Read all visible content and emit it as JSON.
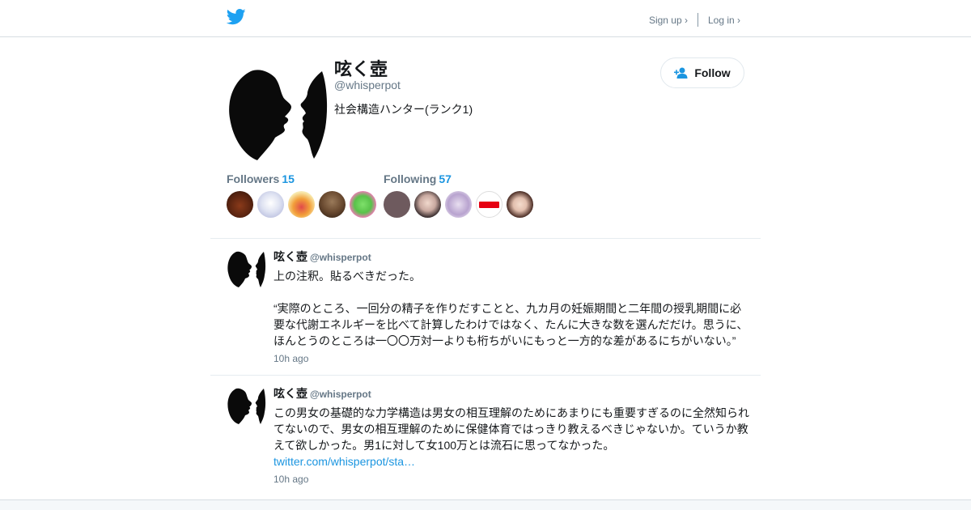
{
  "topbar": {
    "signup": "Sign up ›",
    "login": "Log in ›"
  },
  "profile": {
    "name": "呟く壺",
    "handle": "@whisperpot",
    "bio": "社会構造ハンター(ランク1)",
    "follow_label": "Follow",
    "followers_label": "Followers",
    "followers_count": "15",
    "following_label": "Following",
    "following_count": "57"
  },
  "tweets": [
    {
      "name": "呟く壺",
      "handle": "@whisperpot",
      "line1": "上の注釈。貼るべきだった。",
      "line2": "“実際のところ、一回分の精子を作りだすことと、九カ月の妊娠期間と二年間の授乳期間に必要な代謝エネルギーを比べて計算したわけではなく、たんに大きな数を選んだだけ。思うに、ほんとうのところは一〇〇万対一よりも桁ちがいにもっと一方的な差があるにちがいない。”",
      "time": "10h ago"
    },
    {
      "name": "呟く壺",
      "handle": "@whisperpot",
      "text": "この男女の基礎的な力学構造は男女の相互理解のためにあまりにも重要すぎるのに全然知られてないので、男女の相互理解のために保健体育ではっきり教えるべきじゃないか。ていうか教えて欲しかった。男1に対して女100万とは流石に思ってなかった。",
      "link": "twitter.com/whisperpot/sta…",
      "time": "10h ago"
    }
  ],
  "colors": {
    "brand": "#1da1f2",
    "link": "#1b95e0",
    "muted": "#657786"
  },
  "icons": {
    "logo": "twitter-bird-icon",
    "follow": "add-user-icon"
  }
}
